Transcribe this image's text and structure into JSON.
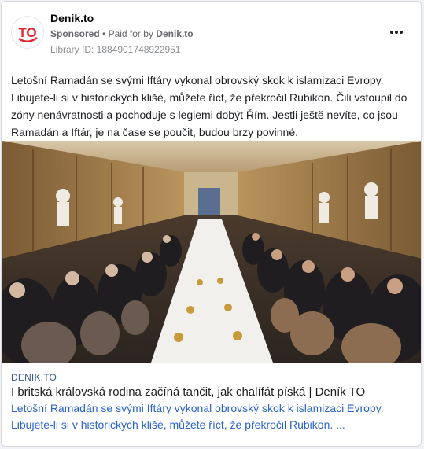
{
  "ad": {
    "page_name": "Denik.to",
    "sponsored_label": "Sponsored",
    "separator": "•",
    "paid_for_prefix": "Paid for by",
    "paid_for_by": "Denik.to",
    "library_id": "Library ID: 1884901748922951",
    "logo_text": "TO",
    "more_icon": "more-horizontal-icon",
    "body_text": "Letošní Ramadán se svými Iftáry vykonal obrovský skok k islamizaci Evropy. Libujete-li si v historických klišé, můžete říct, že překročil Rubikon. Čili vstoupil do zóny nenávratnosti a pochoduje s legiemi dobýt Řím. Jestli ještě nevíte, co jsou Ramadán a Iftár, je na čase se poučit, budou brzy povinné."
  },
  "link": {
    "domain": "DENIK.TO",
    "title": "I britská královská rodina začíná tančit, jak chalífát píská | Deník TO",
    "description": "Letošní Ramadán se svými Iftáry vykonal obrovský skok k islamizaci Evropy. Libujete-li si v historických klišé, můžete říct, že překročil Rubikon. ..."
  },
  "colors": {
    "brand_red": "#e0262b",
    "link_blue": "#2a63c9",
    "domain_blue": "#385898",
    "muted": "#65676b"
  }
}
